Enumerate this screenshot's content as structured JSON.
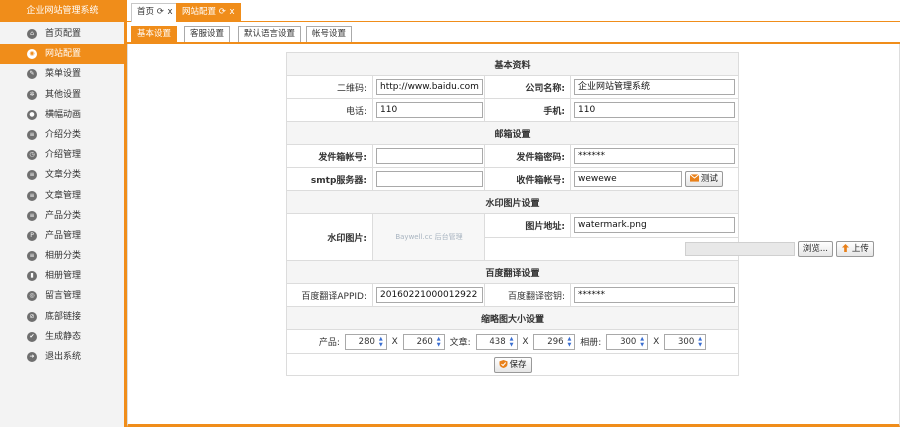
{
  "sidebar": {
    "title": "企业网站管理系统",
    "items": [
      {
        "label": "首页配置",
        "icon": "home-icon",
        "glyph": "⌂"
      },
      {
        "label": "网站配置",
        "icon": "globe-icon",
        "glyph": "◉"
      },
      {
        "label": "菜单设置",
        "icon": "edit-icon",
        "glyph": "✎"
      },
      {
        "label": "其他设置",
        "icon": "gear-icon",
        "glyph": "✲"
      },
      {
        "label": "横幅动画",
        "icon": "banner-icon",
        "glyph": "●"
      },
      {
        "label": "介绍分类",
        "icon": "list-icon",
        "glyph": "≡"
      },
      {
        "label": "介绍管理",
        "icon": "clock-icon",
        "glyph": "◷"
      },
      {
        "label": "文章分类",
        "icon": "list-icon",
        "glyph": "≡"
      },
      {
        "label": "文章管理",
        "icon": "list-icon",
        "glyph": "≡"
      },
      {
        "label": "产品分类",
        "icon": "list-icon",
        "glyph": "≡"
      },
      {
        "label": "产品管理",
        "icon": "product-icon",
        "glyph": "P"
      },
      {
        "label": "相册分类",
        "icon": "list-icon",
        "glyph": "≡"
      },
      {
        "label": "相册管理",
        "icon": "album-icon",
        "glyph": "▮"
      },
      {
        "label": "留言管理",
        "icon": "message-icon",
        "glyph": "◎"
      },
      {
        "label": "底部链接",
        "icon": "link-icon",
        "glyph": "⊘"
      },
      {
        "label": "生成静态",
        "icon": "check-icon",
        "glyph": "✔"
      },
      {
        "label": "退出系统",
        "icon": "logout-icon",
        "glyph": "➜"
      }
    ]
  },
  "page_tabs": [
    {
      "label": "首页",
      "refresh": "⟳",
      "close": "x"
    },
    {
      "label": "网站配置",
      "refresh": "⟳",
      "close": "x"
    }
  ],
  "sub_tabs": [
    "基本设置",
    "客服设置",
    "默认语言设置",
    "帐号设置"
  ],
  "form": {
    "basic": {
      "title": "基本资料",
      "qrcode_label": "二维码:",
      "qrcode_value": "http://www.baidu.com",
      "company_label": "公司名称:",
      "company_value": "企业网站管理系统",
      "phone_label": "电话:",
      "phone_value": "110",
      "mobile_label": "手机:",
      "mobile_value": "110"
    },
    "mail": {
      "title": "邮箱设置",
      "sender_label": "发件箱帐号:",
      "sender_value": "",
      "password_label": "发件箱密码:",
      "password_value": "******",
      "smtp_label": "smtp服务器:",
      "smtp_value": "",
      "receiver_label": "收件箱帐号:",
      "receiver_value": "wewewe",
      "test_button": "测试"
    },
    "watermark": {
      "title": "水印图片设置",
      "image_label": "水印图片:",
      "image_alt": "Baywell.cc 后台管理",
      "path_label": "图片地址:",
      "path_value": "watermark.png",
      "browse_button": "浏览...",
      "upload_button": "上传"
    },
    "translate": {
      "title": "百度翻译设置",
      "appid_label": "百度翻译APPID:",
      "appid_value": "20160221000012922",
      "key_label": "百度翻译密钥:",
      "key_value": "******"
    },
    "thumbnail": {
      "title": "缩略图大小设置",
      "product_label": "产品:",
      "product_w": "280",
      "product_h": "260",
      "article_label": "文章:",
      "article_w": "438",
      "article_h": "296",
      "album_label": "相册:",
      "album_w": "300",
      "album_h": "300",
      "x_sep": "X"
    },
    "save_button": "保存"
  },
  "colors": {
    "accent": "#f08d1a",
    "sidebar_bg": "#f3f3f3",
    "section_bg": "#f5f5f5"
  }
}
